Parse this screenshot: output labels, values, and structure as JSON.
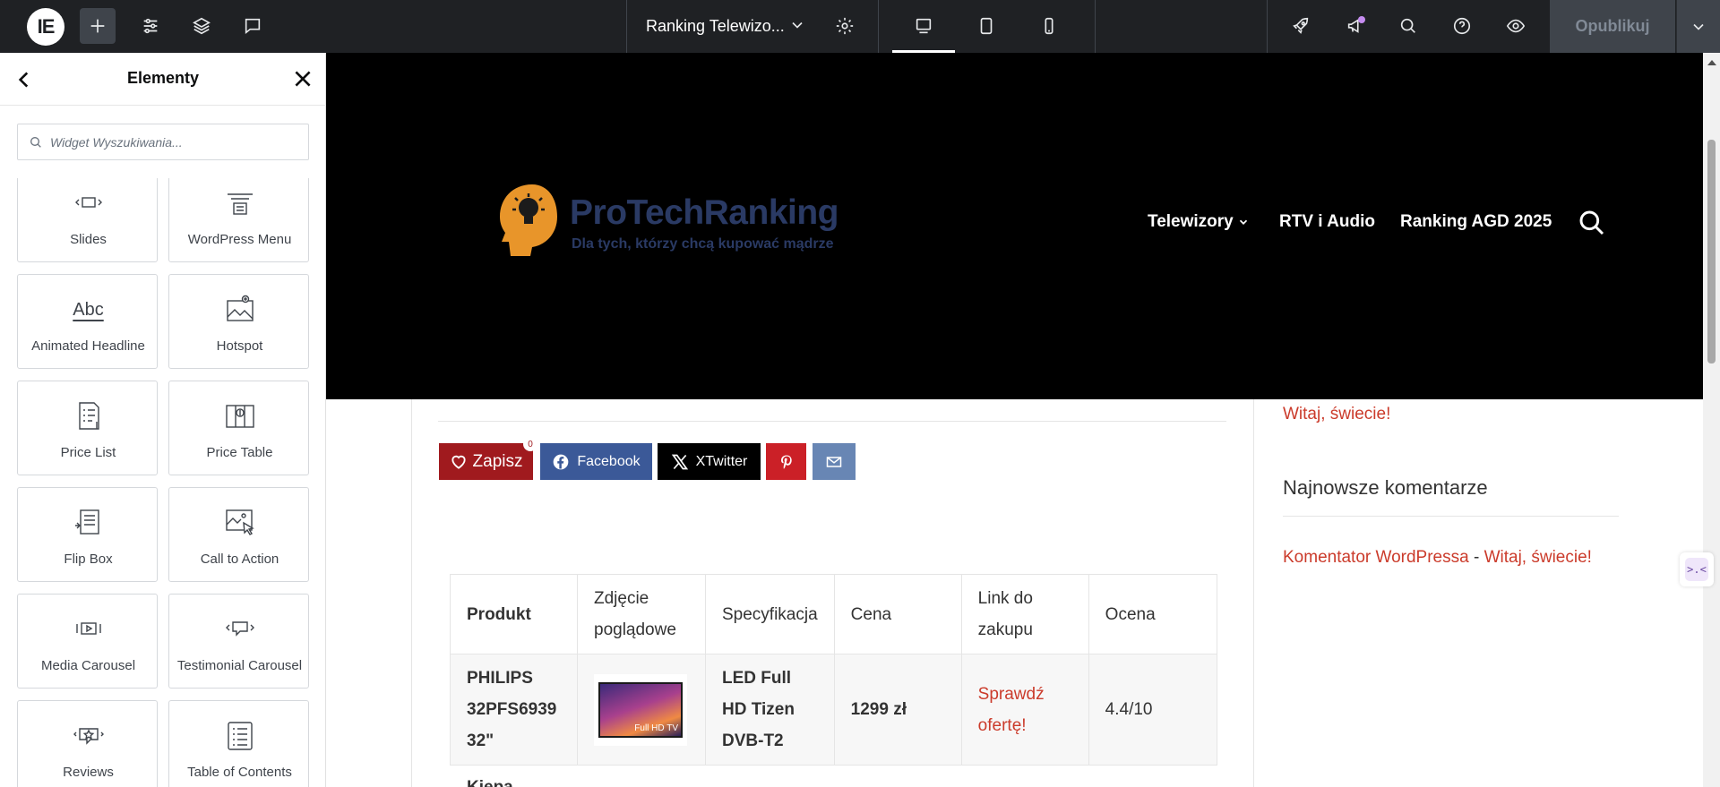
{
  "topbar": {
    "document_title": "Ranking Telewizo...",
    "publish_label": "Opublikuj"
  },
  "panel": {
    "title": "Elementy",
    "search_placeholder": "Widget Wyszukiwania...",
    "widgets": [
      {
        "label": "Slides",
        "icon": "slides-icon"
      },
      {
        "label": "WordPress Menu",
        "icon": "wordpress-menu-icon"
      },
      {
        "label": "Animated Headline",
        "icon": "animated-headline-icon"
      },
      {
        "label": "Hotspot",
        "icon": "hotspot-icon"
      },
      {
        "label": "Price List",
        "icon": "price-list-icon"
      },
      {
        "label": "Price Table",
        "icon": "price-table-icon"
      },
      {
        "label": "Flip Box",
        "icon": "flip-box-icon"
      },
      {
        "label": "Call to Action",
        "icon": "call-to-action-icon"
      },
      {
        "label": "Media Carousel",
        "icon": "media-carousel-icon"
      },
      {
        "label": "Testimonial Carousel",
        "icon": "testimonial-carousel-icon"
      },
      {
        "label": "Reviews",
        "icon": "reviews-icon"
      },
      {
        "label": "Table of Contents",
        "icon": "table-of-contents-icon"
      }
    ],
    "animated_headline_glyph": "Abc"
  },
  "site": {
    "brand_name": "ProTechRanking",
    "brand_tagline": "Dla tych, którzy chcą kupować mądrze",
    "nav": [
      "Telewizory",
      "RTV i Audio",
      "Ranking AGD 2025"
    ],
    "share": {
      "save_label": "Zapisz",
      "save_count": "0",
      "facebook_label": "Facebook",
      "twitter_label": "XTwitter"
    },
    "table": {
      "headers": [
        "Produkt",
        "Zdjęcie poglądowe",
        "Specyfikacja",
        "Cena",
        "Link do zakupu",
        "Ocena"
      ],
      "rows": [
        {
          "product": "PHILIPS 32PFS6939 32\"",
          "image_caption": "Full HD TV",
          "spec": "LED Full HD Tizen DVB-T2",
          "price": "1299 zł",
          "link": "Sprawdź ofertę!",
          "rating": "4.4/10"
        },
        {
          "product": "Kiepa"
        }
      ]
    },
    "sidebar": {
      "recent_post": "Witaj, świecie!",
      "comments_heading": "Najnowsze komentarze",
      "comment_author": "Komentator WordPressa",
      "comment_separator": " - ",
      "comment_post": "Witaj, świecie!"
    }
  },
  "colors": {
    "topbar": "#1f2124",
    "accent_link": "#cb3b2b",
    "brand": "#2a3a64",
    "brand_head": "#e8952a",
    "save": "#a01a1e",
    "facebook": "#3b5998",
    "pinterest": "#cb2027",
    "email": "#6886b4"
  },
  "side_tool_glyph": ">.<"
}
